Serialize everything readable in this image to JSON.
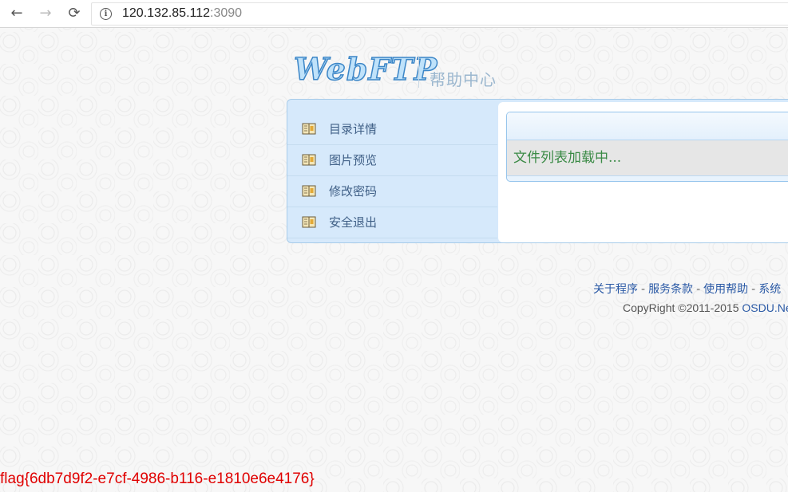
{
  "browser": {
    "back_icon": "←",
    "forward_icon": "→",
    "reload_icon": "⟳",
    "info_icon": "i",
    "url_host": "120.132.85.112",
    "url_port": ":3090"
  },
  "header": {
    "logo_text": "WebFTP",
    "subtitle": "帮助中心"
  },
  "sidebar": {
    "items": [
      {
        "label": "目录详情",
        "icon": "book-icon"
      },
      {
        "label": "图片预览",
        "icon": "book-icon"
      },
      {
        "label": "修改密码",
        "icon": "book-icon"
      },
      {
        "label": "安全退出",
        "icon": "book-icon"
      }
    ]
  },
  "main": {
    "loading_text": "文件列表加载中..."
  },
  "footer": {
    "links": [
      "关于程序",
      "服务条款",
      "使用帮助",
      "系统"
    ],
    "separator": "-",
    "copyright_text": "CopyRight ©2011-2015 ",
    "copyright_link": "OSDU.Net"
  },
  "flag_text": "flag{6db7d9f2-e7cf-4986-b116-e1810e6e4176}",
  "colors": {
    "accent": "#3c86c7",
    "panel_bg": "#d6e9fb",
    "flag": "#e00000",
    "loading": "#3a8a45"
  }
}
